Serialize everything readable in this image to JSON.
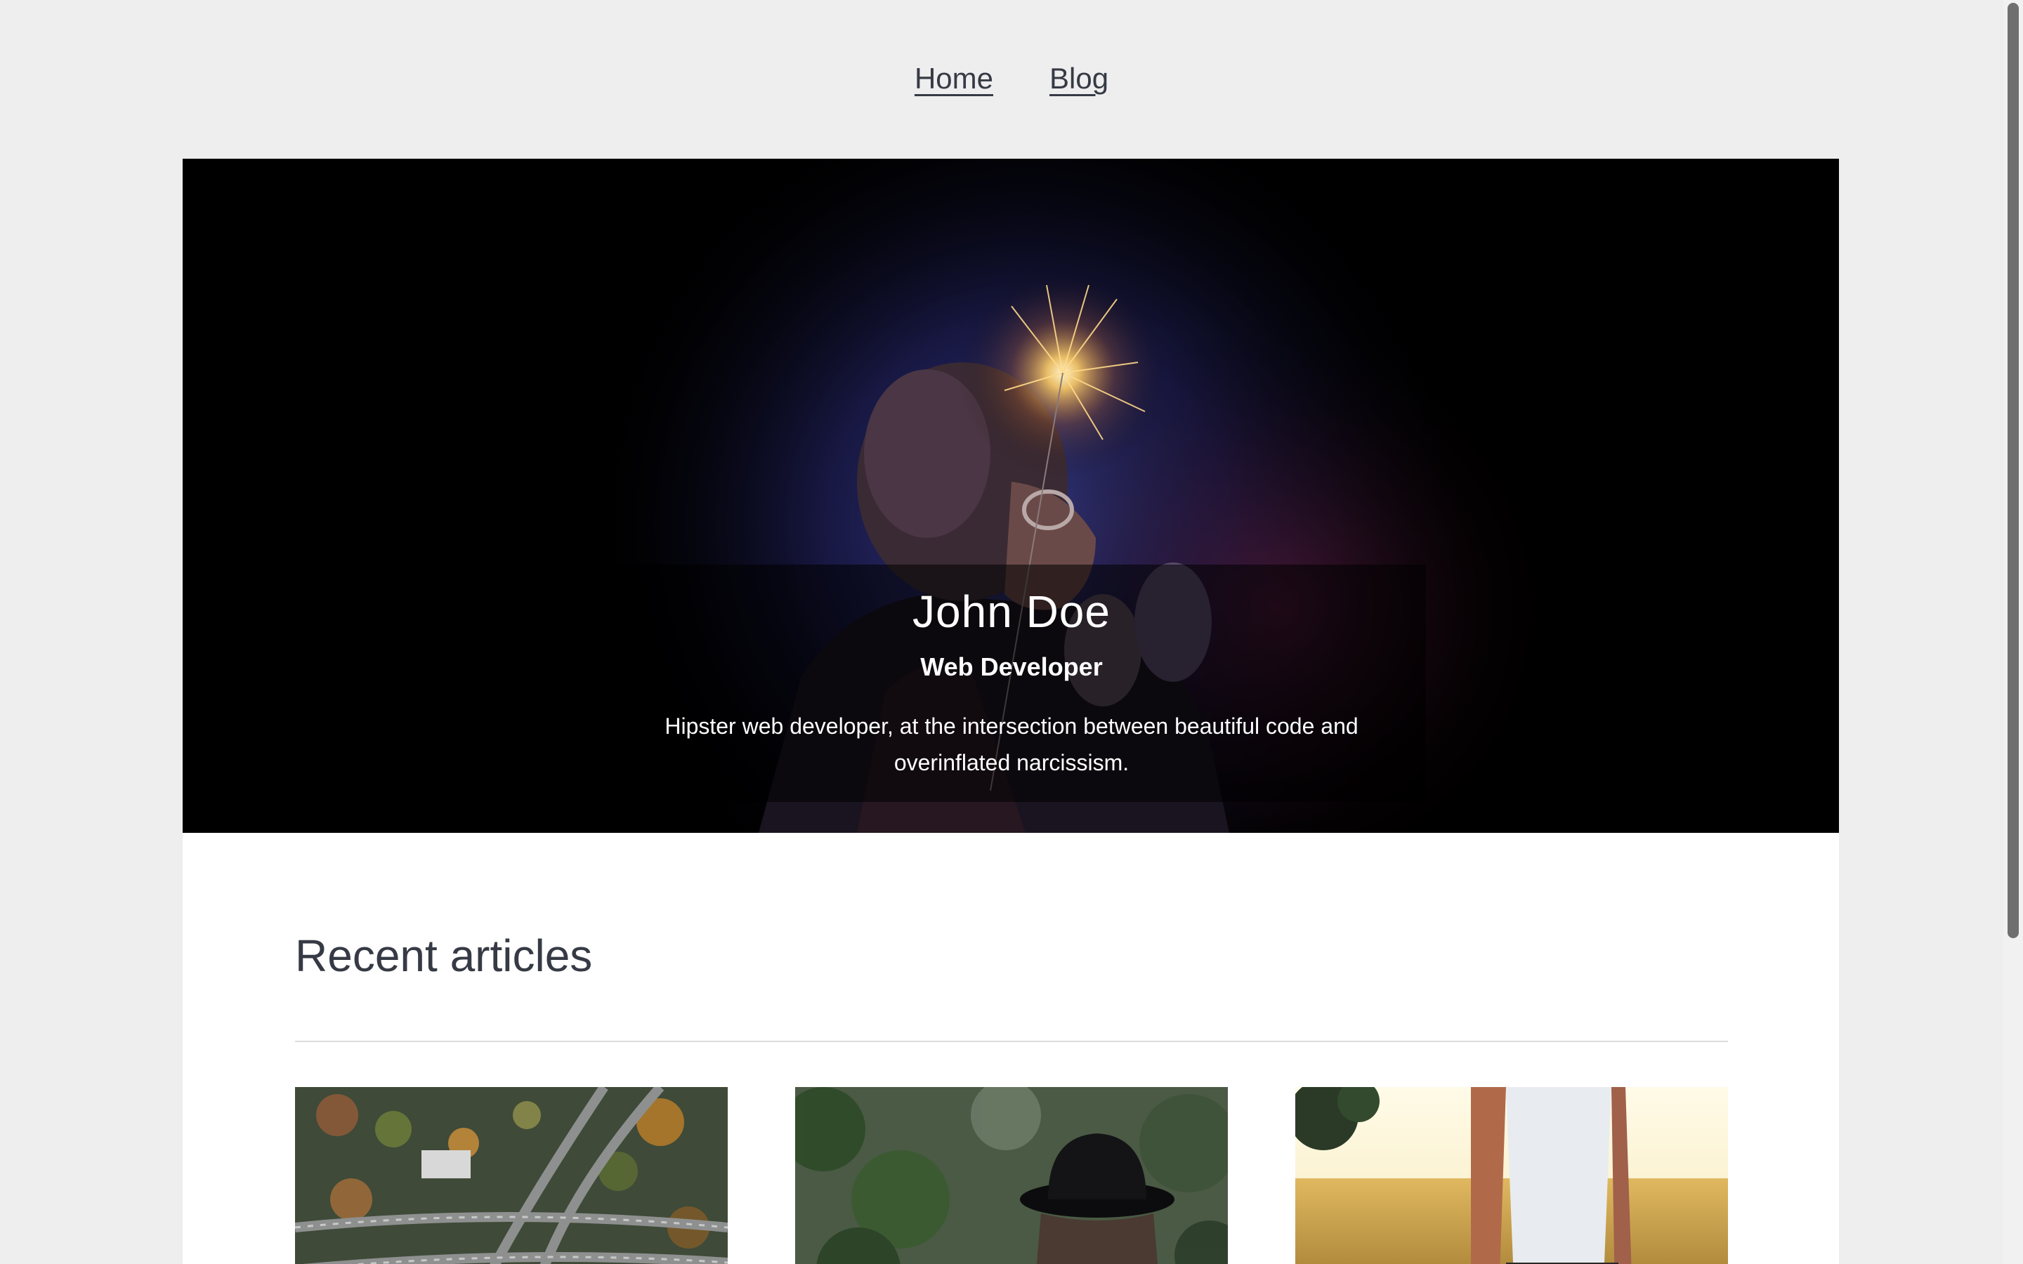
{
  "nav": {
    "links": [
      {
        "label": "Home"
      },
      {
        "label": "Blog"
      }
    ]
  },
  "hero": {
    "name": "John Doe",
    "role": "Web Developer",
    "bio": "Hipster web developer, at the intersection between beautiful code and overinflated narcissism."
  },
  "articles_section": {
    "title": "Recent articles"
  },
  "colors": {
    "page_background": "#eeeeee",
    "card_background": "#ffffff",
    "text": "#363a45",
    "hero_background": "#000000"
  }
}
